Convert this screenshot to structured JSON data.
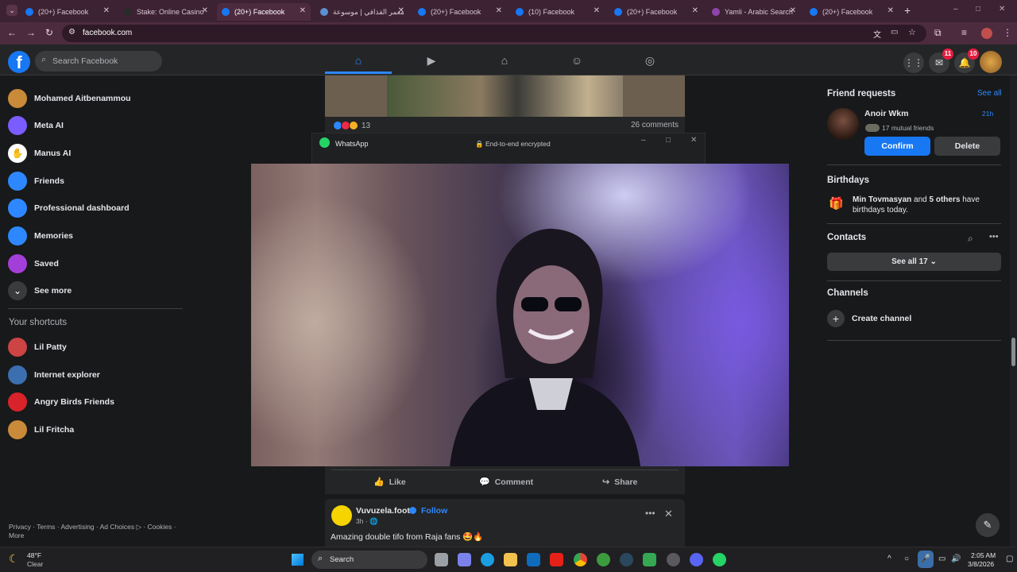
{
  "browser": {
    "tabs": [
      {
        "title": "(20+) Facebook",
        "icon": "facebook-icon",
        "color": "#1877f2",
        "active": false
      },
      {
        "title": "Stake: Online Casino",
        "icon": "stake-icon",
        "color": "#2a2a2a",
        "active": false
      },
      {
        "title": "(20+) Facebook",
        "icon": "facebook-icon",
        "color": "#1877f2",
        "active": true
      },
      {
        "title": "معمر القذافي | موسوعة",
        "icon": "wiki-icon",
        "color": "#5b8fd1",
        "active": false
      },
      {
        "title": "(20+) Facebook",
        "icon": "facebook-icon",
        "color": "#1877f2",
        "active": false
      },
      {
        "title": "(10) Facebook",
        "icon": "facebook-icon",
        "color": "#1877f2",
        "active": false
      },
      {
        "title": "(20+) Facebook",
        "icon": "facebook-icon",
        "color": "#1877f2",
        "active": false
      },
      {
        "title": "Yamli - Arabic Search",
        "icon": "yamli-icon",
        "color": "#8e44ad",
        "active": false
      },
      {
        "title": "(20+) Facebook",
        "icon": "facebook-icon",
        "color": "#1877f2",
        "active": false
      }
    ],
    "new_tab": "+",
    "url": "facebook.com",
    "window_controls": [
      "–",
      "□",
      "✕"
    ]
  },
  "fb": {
    "search_placeholder": "Search Facebook",
    "messenger_badge": "11",
    "notifications_badge": "10"
  },
  "sidebar": {
    "items": [
      {
        "label": "Mohamed Aitbenammou",
        "icon": "profile-avatar",
        "color": "#c98a3a"
      },
      {
        "label": "Meta AI",
        "icon": "meta-ai-icon",
        "color": "#7b5cff"
      },
      {
        "label": "Manus AI",
        "icon": "manus-ai-icon",
        "color": "#ffffff"
      },
      {
        "label": "Friends",
        "icon": "friends-icon",
        "color": "#2d88ff"
      },
      {
        "label": "Professional dashboard",
        "icon": "dashboard-icon",
        "color": "#2d88ff"
      },
      {
        "label": "Memories",
        "icon": "memories-icon",
        "color": "#2d88ff"
      },
      {
        "label": "Saved",
        "icon": "saved-icon",
        "color": "#a33ed8"
      },
      {
        "label": "See more",
        "icon": "chevron-down-icon",
        "color": "#3a3b3c"
      }
    ],
    "shortcuts_title": "Your shortcuts",
    "shortcuts": [
      {
        "label": "Lil Patty",
        "color": "#c44"
      },
      {
        "label": "Internet explorer",
        "color": "#3b6fb0"
      },
      {
        "label": "Angry Birds Friends",
        "color": "#d8232a"
      },
      {
        "label": "Lil Fritcha",
        "color": "#c98a3a"
      }
    ],
    "footer": "Privacy · Terms · Advertising · Ad Choices ▷ · Cookies · More"
  },
  "feed": {
    "post1": {
      "reaction_count": "13",
      "comments": "26 comments"
    },
    "actions": {
      "like": "Like",
      "comment": "Comment",
      "share": "Share"
    },
    "post2": {
      "author": "Vuvuzela.foot",
      "follow": "Follow",
      "time": "3h · 🌐",
      "text": "Amazing double tifo from Raja fans 🤩🔥"
    }
  },
  "whatsapp": {
    "title": "WhatsApp",
    "encryption": "🔒 End-to-end encrypted"
  },
  "right": {
    "friend_requests_title": "Friend requests",
    "see_all": "See all",
    "request": {
      "name": "Anoir Wkm",
      "time": "21h",
      "mutual": "17 mutual friends"
    },
    "confirm": "Confirm",
    "delete": "Delete",
    "birthdays_title": "Birthdays",
    "birthday_name": "Min Tovmasyan",
    "birthday_and": " and ",
    "birthday_others": "5 others",
    "birthday_rest": " have birthdays today.",
    "contacts_title": "Contacts",
    "see_all_contacts": "See all 17",
    "channels_title": "Channels",
    "create_channel": "Create channel"
  },
  "taskbar": {
    "weather_temp": "48°F",
    "weather_cond": "Clear",
    "search": "Search",
    "time": "2:05 AM",
    "date": "3/8/2026"
  }
}
